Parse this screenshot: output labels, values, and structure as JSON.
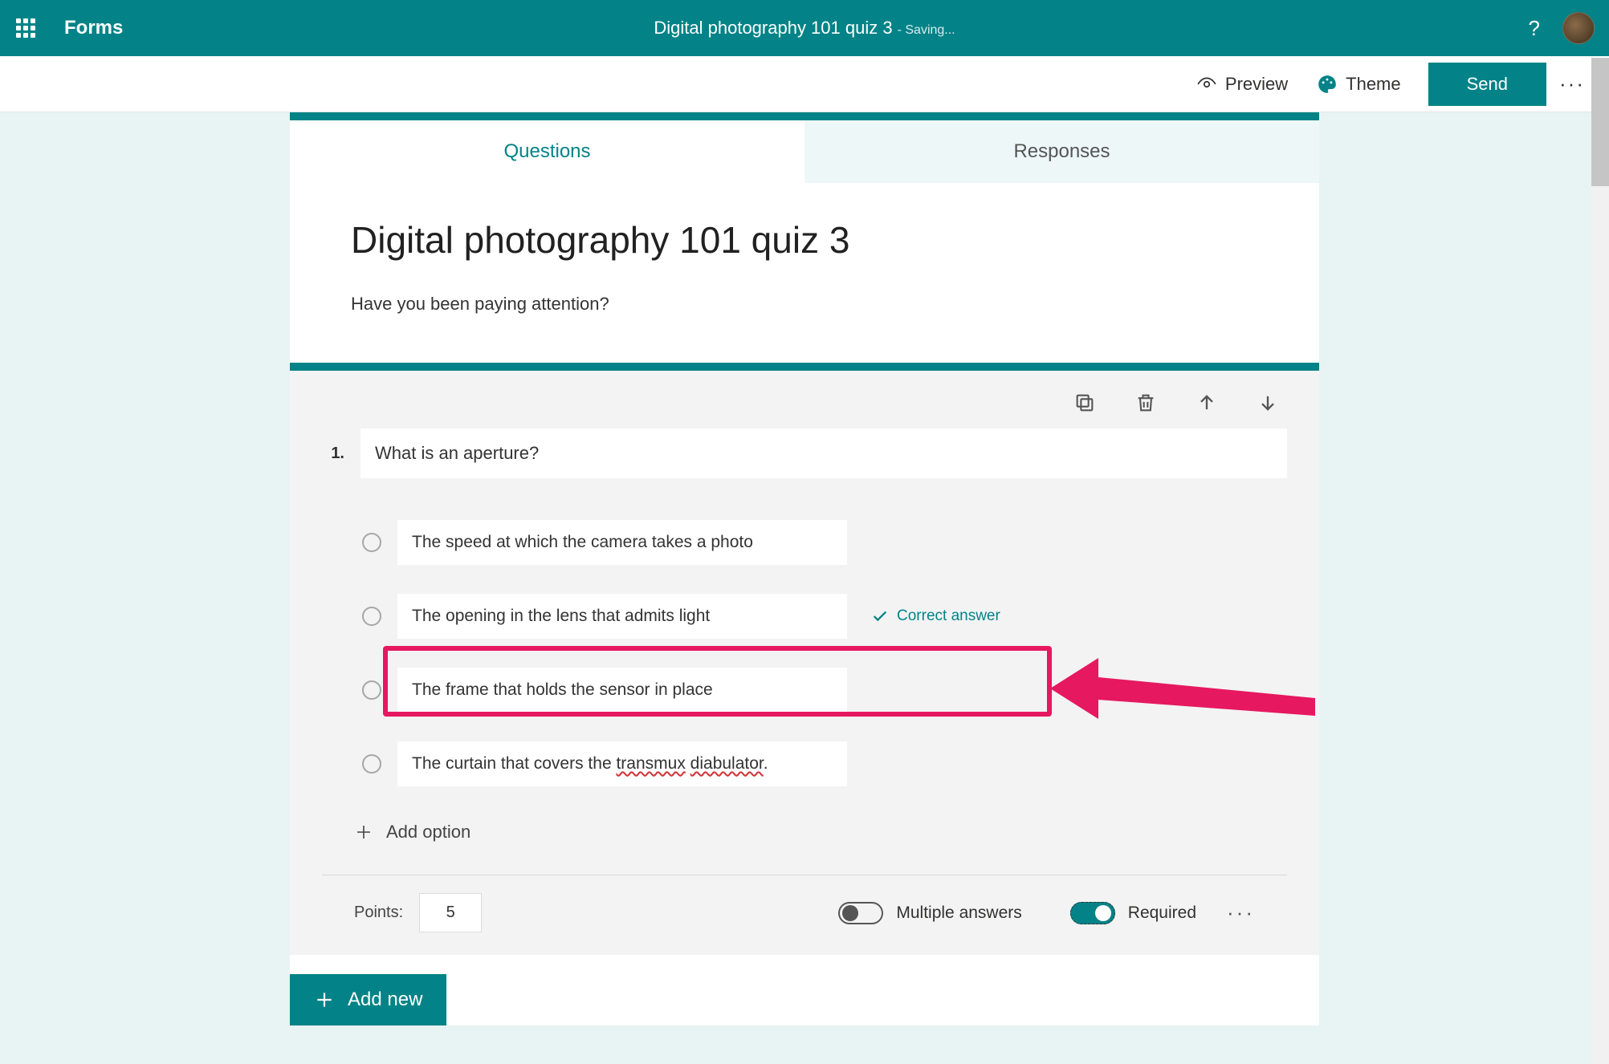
{
  "header": {
    "app_name": "Forms",
    "doc_title": "Digital photography 101 quiz 3",
    "saving_label": "- Saving..."
  },
  "toolbar": {
    "preview_label": "Preview",
    "theme_label": "Theme",
    "send_label": "Send"
  },
  "tabs": {
    "questions_label": "Questions",
    "responses_label": "Responses"
  },
  "form": {
    "title": "Digital photography 101 quiz 3",
    "description": "Have you been paying attention?"
  },
  "question": {
    "number": "1.",
    "text": "What is an aperture?",
    "options": {
      "0": {
        "text": "The speed at which the camera takes a photo"
      },
      "1": {
        "text": "The opening in the lens that admits light"
      },
      "2": {
        "text": "The frame that holds the sensor in place"
      },
      "3": {
        "text_prefix": "The curtain that covers the ",
        "err1": "transmux",
        "sep": " ",
        "err2": "diabulator",
        "suffix": "."
      }
    },
    "correct_label": "Correct answer",
    "add_option_label": "Add option",
    "points_label": "Points:",
    "points_value": "5",
    "multi_label": "Multiple answers",
    "required_label": "Required"
  },
  "buttons": {
    "add_new_label": "Add new"
  },
  "icons": {
    "help": "?",
    "more": "···"
  }
}
